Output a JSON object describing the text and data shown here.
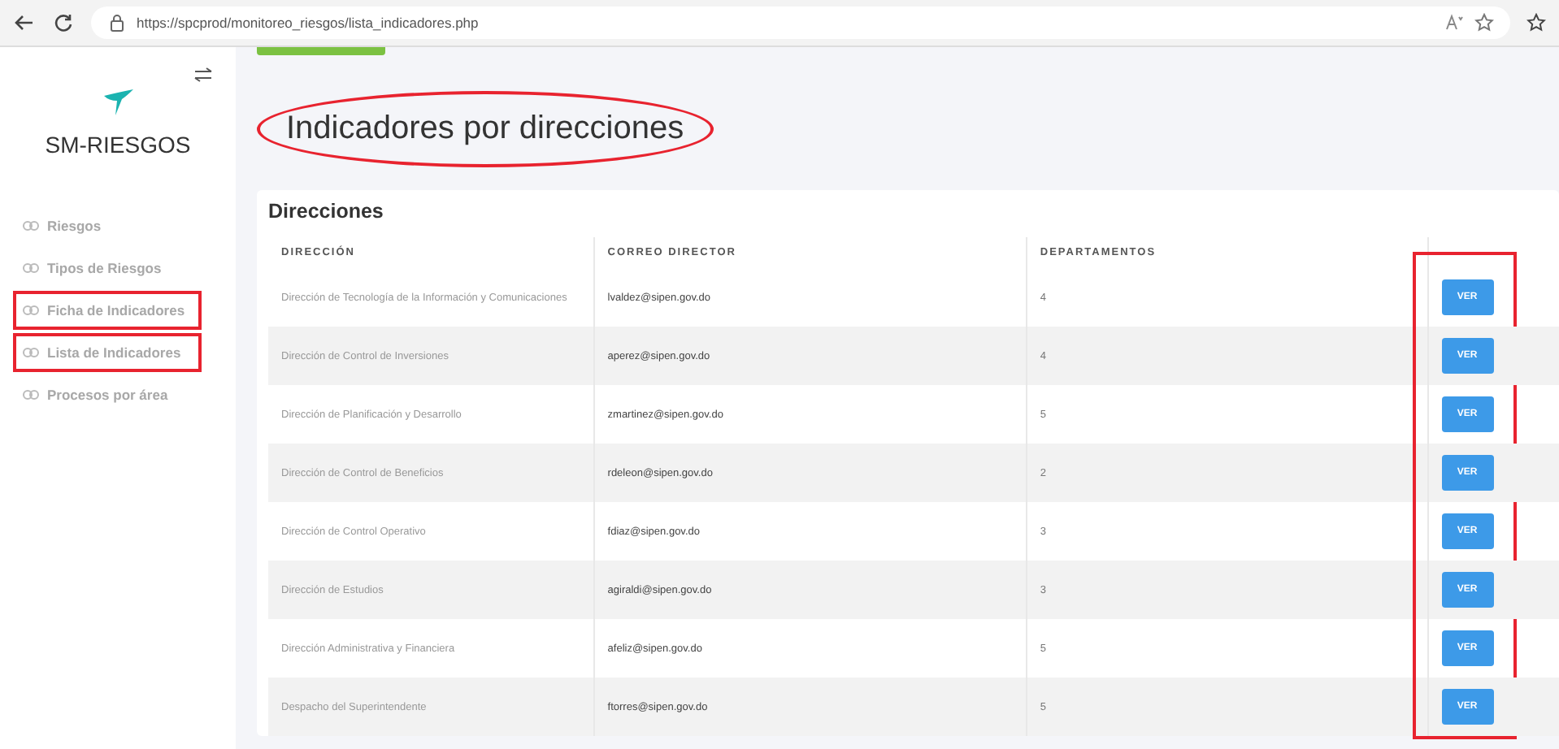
{
  "browser": {
    "url": "https://spcprod/monitoreo_riesgos/lista_indicadores.php"
  },
  "sidebar": {
    "brand": "SM-RIESGOS",
    "items": [
      {
        "label": "Riesgos",
        "highlighted": false
      },
      {
        "label": "Tipos de Riesgos",
        "highlighted": false
      },
      {
        "label": "Ficha de Indicadores",
        "highlighted": true
      },
      {
        "label": "Lista de Indicadores",
        "highlighted": true
      },
      {
        "label": "Procesos por área",
        "highlighted": false
      }
    ]
  },
  "page": {
    "title": "Indicadores por direcciones",
    "title_circled": true
  },
  "card": {
    "title": "Direcciones",
    "actions_highlighted": true,
    "columns": [
      "DIRECCIÓN",
      "CORREO DIRECTOR",
      "DEPARTAMENTOS"
    ],
    "rows": [
      {
        "direccion": "Dirección de Tecnología de la Información y Comunicaciones",
        "correo": "lvaldez@sipen.gov.do",
        "departamentos": "4",
        "action": "VER"
      },
      {
        "direccion": "Dirección de Control de Inversiones",
        "correo": "aperez@sipen.gov.do",
        "departamentos": "4",
        "action": "VER"
      },
      {
        "direccion": "Dirección de Planificación y Desarrollo",
        "correo": "zmartinez@sipen.gov.do",
        "departamentos": "5",
        "action": "VER"
      },
      {
        "direccion": "Dirección de Control de Beneficios",
        "correo": "rdeleon@sipen.gov.do",
        "departamentos": "2",
        "action": "VER"
      },
      {
        "direccion": "Dirección de Control Operativo",
        "correo": "fdiaz@sipen.gov.do",
        "departamentos": "3",
        "action": "VER"
      },
      {
        "direccion": "Dirección de Estudios",
        "correo": "agiraldi@sipen.gov.do",
        "departamentos": "3",
        "action": "VER"
      },
      {
        "direccion": "Dirección Administrativa y Financiera",
        "correo": "afeliz@sipen.gov.do",
        "departamentos": "5",
        "action": "VER"
      },
      {
        "direccion": "Despacho del Superintendente",
        "correo": "ftorres@sipen.gov.do",
        "departamentos": "5",
        "action": "VER"
      }
    ]
  }
}
